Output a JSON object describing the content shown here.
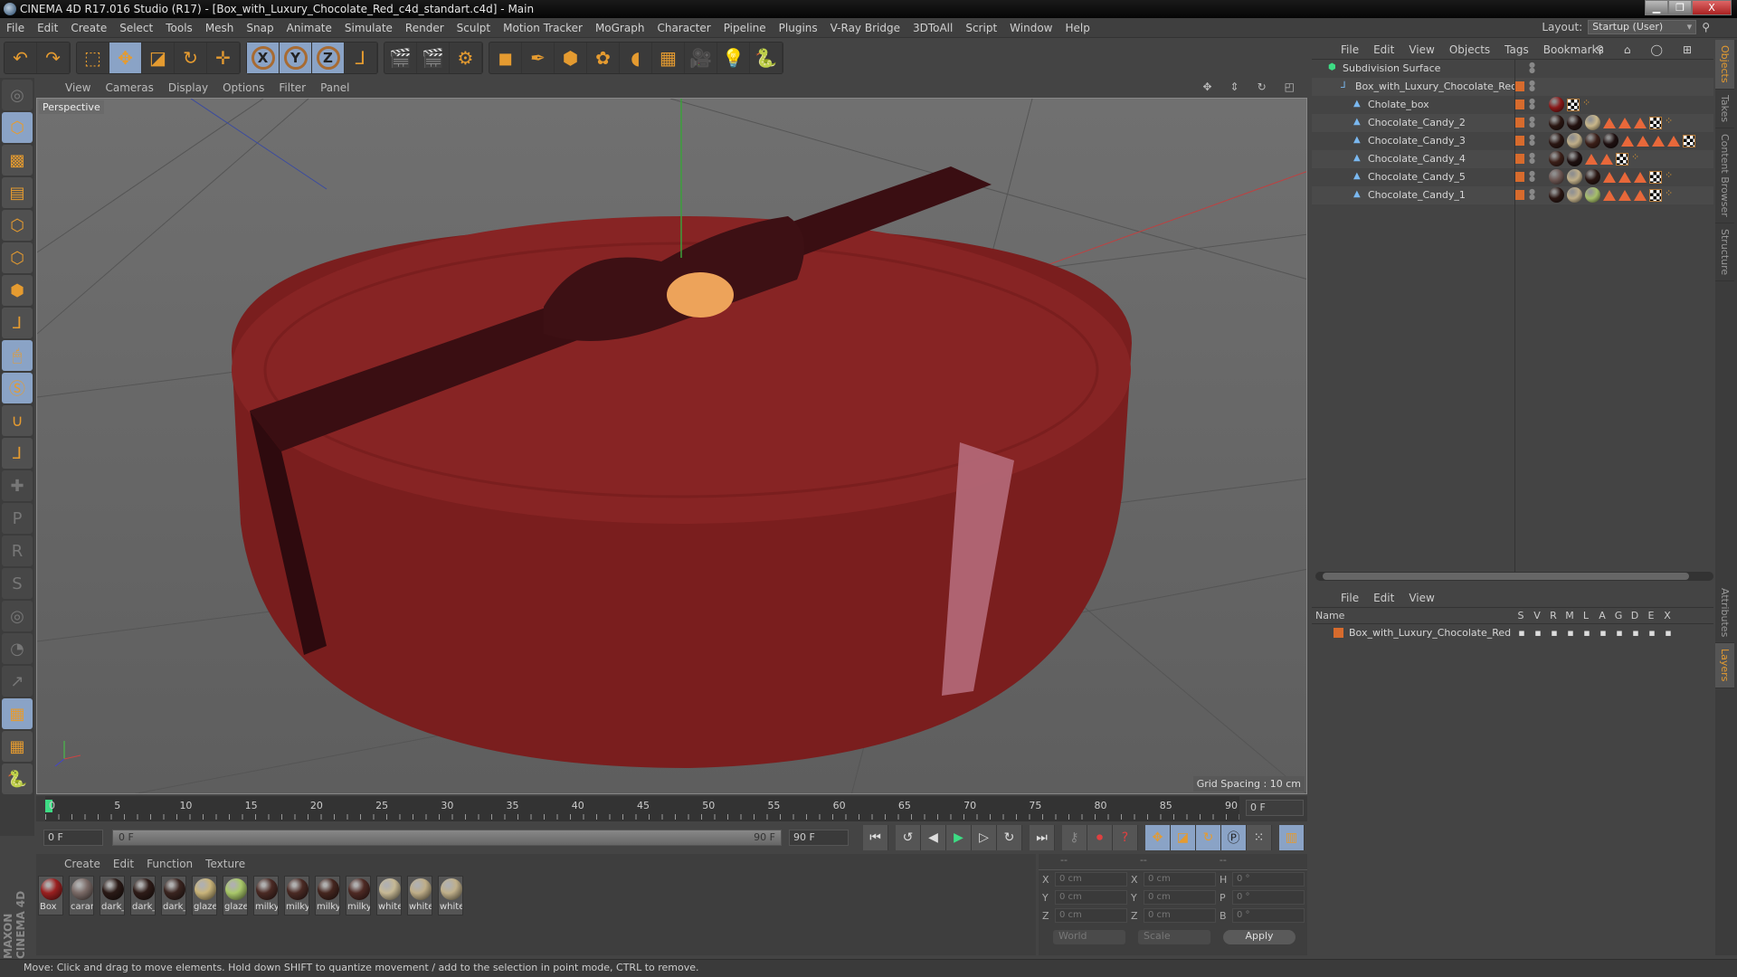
{
  "window": {
    "title": "CINEMA 4D R17.016 Studio (R17) - [Box_with_Luxury_Chocolate_Red_c4d_standart.c4d] - Main",
    "controls": [
      "minimize",
      "restore",
      "close"
    ]
  },
  "menubar": {
    "items": [
      "File",
      "Edit",
      "Create",
      "Select",
      "Tools",
      "Mesh",
      "Snap",
      "Animate",
      "Simulate",
      "Render",
      "Sculpt",
      "Motion Tracker",
      "MoGraph",
      "Character",
      "Pipeline",
      "Plugins",
      "V-Ray Bridge",
      "3DToAll",
      "Script",
      "Window",
      "Help"
    ],
    "layout_label": "Layout:",
    "layout_value": "Startup (User)"
  },
  "toolbar": {
    "groups": [
      [
        {
          "icon": "undo-icon",
          "glyph": "↶"
        },
        {
          "icon": "redo-icon",
          "glyph": "↷"
        }
      ],
      [
        {
          "icon": "live-selection-icon",
          "glyph": "⬚"
        },
        {
          "icon": "move-icon",
          "glyph": "✥",
          "active": true
        },
        {
          "icon": "scale-icon",
          "glyph": "◪"
        },
        {
          "icon": "rotate-icon",
          "glyph": "↻"
        },
        {
          "icon": "last-tool-icon",
          "glyph": "✛"
        }
      ],
      [
        {
          "icon": "x-axis-icon",
          "glyph": "X",
          "active": true
        },
        {
          "icon": "y-axis-icon",
          "glyph": "Y",
          "active": true
        },
        {
          "icon": "z-axis-icon",
          "glyph": "Z",
          "active": true
        },
        {
          "icon": "coordinate-system-icon",
          "glyph": "⅃"
        }
      ],
      [
        {
          "icon": "render-view-icon",
          "glyph": "🎬"
        },
        {
          "icon": "render-picture-viewer-icon",
          "glyph": "🎬"
        },
        {
          "icon": "render-settings-icon",
          "glyph": "⚙"
        }
      ],
      [
        {
          "icon": "cube-icon",
          "glyph": "◼"
        },
        {
          "icon": "pen-spline-icon",
          "glyph": "✒"
        },
        {
          "icon": "subdivision-surface-icon",
          "glyph": "⬢"
        },
        {
          "icon": "cloner-icon",
          "glyph": "✿"
        },
        {
          "icon": "deformer-icon",
          "glyph": "◖"
        },
        {
          "icon": "floor-icon",
          "glyph": "▦"
        },
        {
          "icon": "camera-icon",
          "glyph": "🎥"
        },
        {
          "icon": "light-icon",
          "glyph": "💡"
        },
        {
          "icon": "python-icon",
          "glyph": "🐍"
        }
      ]
    ]
  },
  "left_tools": [
    {
      "icon": "make-editable-icon",
      "glyph": "◎",
      "dim": true
    },
    {
      "icon": "model-mode-icon",
      "glyph": "⬡",
      "active": true
    },
    {
      "icon": "texture-mode-icon",
      "glyph": "▩"
    },
    {
      "icon": "workplane-mode-icon",
      "glyph": "▤"
    },
    {
      "icon": "points-mode-icon",
      "glyph": "⬡"
    },
    {
      "icon": "edges-mode-icon",
      "glyph": "⬡"
    },
    {
      "icon": "polygons-mode-icon",
      "glyph": "⬢"
    },
    {
      "icon": "axis-mode-icon",
      "glyph": "⅃"
    },
    {
      "icon": "tweak-mode-icon",
      "glyph": "🖱",
      "active": true
    },
    {
      "icon": "snap-icon",
      "glyph": "Ⓢ",
      "active": true
    },
    {
      "icon": "magnet-icon",
      "glyph": "∪"
    },
    {
      "icon": "workplane-axis-icon",
      "glyph": "⅃"
    },
    {
      "icon": "brush-add-icon",
      "glyph": "✚",
      "dim": true
    },
    {
      "icon": "brush-p-icon",
      "glyph": "P",
      "dim": true
    },
    {
      "icon": "brush-r-icon",
      "glyph": "R",
      "dim": true
    },
    {
      "icon": "brush-psr-icon",
      "glyph": "S",
      "dim": true
    },
    {
      "icon": "brush-target-icon",
      "glyph": "◎",
      "dim": true
    },
    {
      "icon": "brush-pie-icon",
      "glyph": "◔",
      "dim": true
    },
    {
      "icon": "brush-arrow-icon",
      "glyph": "↗",
      "dim": true
    },
    {
      "icon": "locked-workplane-icon",
      "glyph": "▦",
      "active": true
    },
    {
      "icon": "workplane-rotate-icon",
      "glyph": "▦"
    },
    {
      "icon": "python-icon",
      "glyph": "🐍"
    }
  ],
  "brand": "MAXON CINEMA 4D",
  "viewport": {
    "menu": [
      "View",
      "Cameras",
      "Display",
      "Options",
      "Filter",
      "Panel"
    ],
    "camera_label": "Perspective",
    "grid_spacing": "Grid Spacing : 10 cm",
    "nav_icons": [
      "move-view-icon",
      "dolly-view-icon",
      "rotate-view-icon",
      "maximize-view-icon"
    ]
  },
  "timeline": {
    "ticks": [
      "0",
      "5",
      "10",
      "15",
      "20",
      "25",
      "30",
      "35",
      "40",
      "45",
      "50",
      "55",
      "60",
      "65",
      "70",
      "75",
      "80",
      "85",
      "90"
    ],
    "current_frame": "0 F",
    "start_field": "0 F",
    "range_start": "0 F",
    "range_end": "90 F",
    "end_field": "90 F"
  },
  "transport": {
    "buttons": [
      "go-to-start-icon",
      "previous-key-icon",
      "previous-frame-icon",
      "play-icon",
      "next-frame-icon",
      "next-key-icon",
      "go-to-end-icon"
    ],
    "record_buttons": [
      "autokey-icon",
      "record-icon",
      "help-keyframe-icon"
    ],
    "key_buttons": [
      "key-position-icon",
      "key-scale-icon",
      "key-rotation-icon",
      "key-parameter-icon",
      "key-pla-icon",
      "timeline-icon"
    ]
  },
  "materials": {
    "menu": [
      "Create",
      "Edit",
      "Function",
      "Texture"
    ],
    "items": [
      {
        "label": "Box",
        "color": "#9a2020"
      },
      {
        "label": "caran",
        "color": "#7a6a66"
      },
      {
        "label": "dark_",
        "color": "#2a1a16"
      },
      {
        "label": "dark_",
        "color": "#2e1c18"
      },
      {
        "label": "dark_",
        "color": "#3a2520"
      },
      {
        "label": "glaze",
        "color": "#c9b47a"
      },
      {
        "label": "glaze",
        "color": "#a9c86a"
      },
      {
        "label": "milky",
        "color": "#4a2a24"
      },
      {
        "label": "milky",
        "color": "#4a2a24"
      },
      {
        "label": "milky",
        "color": "#45261f"
      },
      {
        "label": "milky",
        "color": "#4e2a24"
      },
      {
        "label": "white",
        "color": "#c6b894"
      },
      {
        "label": "white",
        "color": "#bfae88"
      },
      {
        "label": "white",
        "color": "#c0b08a"
      }
    ]
  },
  "coordinates": {
    "headers": [
      "--",
      "--",
      "--"
    ],
    "rows": [
      {
        "l1": "X",
        "v1": "0 cm",
        "l2": "X",
        "v2": "0 cm",
        "l3": "H",
        "v3": "0 °"
      },
      {
        "l1": "Y",
        "v1": "0 cm",
        "l2": "Y",
        "v2": "0 cm",
        "l3": "P",
        "v3": "0 °"
      },
      {
        "l1": "Z",
        "v1": "0 cm",
        "l2": "Z",
        "v2": "0 cm",
        "l3": "B",
        "v3": "0 °"
      }
    ],
    "space": "World",
    "mode": "Scale",
    "apply": "Apply"
  },
  "objects": {
    "menu": [
      "File",
      "Edit",
      "View",
      "Objects",
      "Tags",
      "Bookmarks"
    ],
    "rows": [
      {
        "name": "Subdivision Surface",
        "indent": 0,
        "icon": "subdivision-surface-icon",
        "tags": []
      },
      {
        "name": "Box_with_Luxury_Chocolate_Red",
        "indent": 1,
        "icon": "null-object-icon",
        "tags": []
      },
      {
        "name": "Cholate_box",
        "indent": 2,
        "icon": "polygon-object-icon",
        "tags": [
          "m:#8a1818",
          "c",
          "p"
        ]
      },
      {
        "name": "Chocolate_Candy_2",
        "indent": 2,
        "icon": "polygon-object-icon",
        "tags": [
          "m:#2a1612",
          "m:#231210",
          "m:#c9b78a",
          "t",
          "t",
          "t",
          "c",
          "p"
        ]
      },
      {
        "name": "Chocolate_Candy_3",
        "indent": 2,
        "icon": "polygon-object-icon",
        "tags": [
          "m:#2a1612",
          "m:#bfae88",
          "m:#3b1f18",
          "m:#1e1010",
          "t",
          "t",
          "t",
          "t",
          "c"
        ]
      },
      {
        "name": "Chocolate_Candy_4",
        "indent": 2,
        "icon": "polygon-object-icon",
        "tags": [
          "m:#3b1f18",
          "m:#1e1010",
          "t",
          "t",
          "c",
          "p"
        ]
      },
      {
        "name": "Chocolate_Candy_5",
        "indent": 2,
        "icon": "polygon-object-icon",
        "tags": [
          "m:#6a5450",
          "m:#bfae88",
          "m:#2a1612",
          "t",
          "t",
          "t",
          "c",
          "p"
        ]
      },
      {
        "name": "Chocolate_Candy_1",
        "indent": 2,
        "icon": "polygon-object-icon",
        "tags": [
          "m:#2a1612",
          "m:#bfae88",
          "m:#a6bf6a",
          "t",
          "t",
          "t",
          "c",
          "p"
        ]
      }
    ]
  },
  "layers": {
    "menu": [
      "File",
      "Edit",
      "View"
    ],
    "columns": [
      "Name",
      "S",
      "V",
      "R",
      "M",
      "L",
      "A",
      "G",
      "D",
      "E",
      "X"
    ],
    "rows": [
      {
        "name": "Box_with_Luxury_Chocolate_Red",
        "color": "#d76b2d"
      }
    ]
  },
  "side_tabs": {
    "top": [
      {
        "label": "Objects",
        "active": true
      },
      {
        "label": "Takes"
      },
      {
        "label": "Content Browser"
      },
      {
        "label": "Structure"
      }
    ],
    "bottom": [
      {
        "label": "Attributes"
      },
      {
        "label": "Layers",
        "active": true
      }
    ]
  },
  "status_bar": "Move: Click and drag to move elements. Hold down SHIFT to quantize movement / add to the selection in point mode, CTRL to remove.",
  "colors": {
    "accent": "#e59b30",
    "selected": "#8aa3c6",
    "layer": "#d76b2d",
    "box_red": "#8a2222"
  }
}
